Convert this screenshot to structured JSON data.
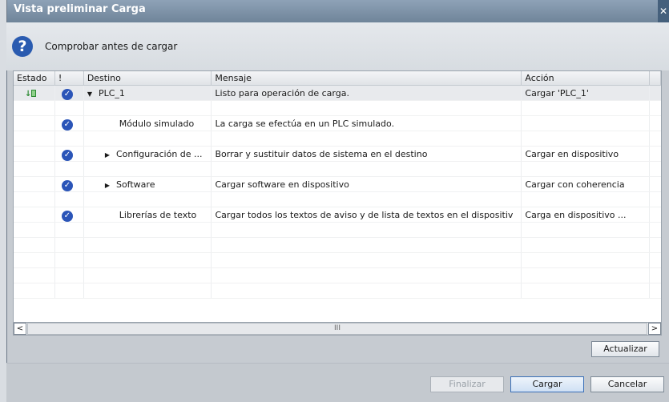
{
  "window": {
    "title": "Vista preliminar Carga",
    "close_glyph": "✕"
  },
  "header": {
    "icon": "question-icon",
    "title": "Comprobar antes de cargar"
  },
  "columns": [
    "Estado",
    "!",
    "Destino",
    "Mensaje",
    "Acción"
  ],
  "rows": [
    {
      "destino": "PLC_1",
      "mensaje": "Listo para operación de carga.",
      "accion": "Cargar 'PLC_1'",
      "expander": "▼",
      "has_status": true
    },
    {
      "destino": "Módulo simulado",
      "mensaje": "La carga se efectúa en un PLC simulado.",
      "accion": "",
      "expander": "",
      "has_status": false
    },
    {
      "destino": "Configuración de ...",
      "mensaje": "Borrar y sustituir datos de sistema en el destino",
      "accion": "Cargar en dispositivo",
      "expander": "▶",
      "has_status": false
    },
    {
      "destino": "Software",
      "mensaje": "Cargar software en dispositivo",
      "accion": "Cargar con coherencia",
      "expander": "▶",
      "has_status": false
    },
    {
      "destino": "Librerías de texto",
      "mensaje": "Cargar todos los textos de aviso y de lista de textos en el dispositiv",
      "accion": "Carga en dispositivo ...",
      "expander": "",
      "has_status": false
    }
  ],
  "scrollbar": {
    "left": "<",
    "right": ">",
    "thumb": "III"
  },
  "buttons": {
    "actualizar": "Actualizar",
    "finalizar": "Finalizar",
    "cargar": "Cargar",
    "cancelar": "Cancelar"
  },
  "colors": {
    "accent": "#2b55b8",
    "status_green": "#2c8a33"
  }
}
